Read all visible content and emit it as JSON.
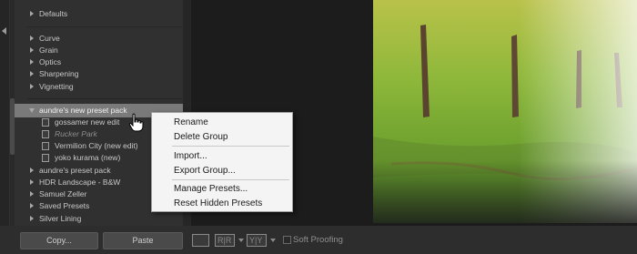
{
  "preset_tree": {
    "rows": [
      {
        "label": "Defaults",
        "kind": "folder"
      },
      {
        "label": "Curve",
        "kind": "folder"
      },
      {
        "label": "Grain",
        "kind": "folder"
      },
      {
        "label": "Optics",
        "kind": "folder"
      },
      {
        "label": "Sharpening",
        "kind": "folder"
      },
      {
        "label": "Vignetting",
        "kind": "folder"
      },
      {
        "label": "aundre's new preset pack",
        "kind": "folder-open",
        "selected": true
      },
      {
        "label": "gossamer new edit",
        "kind": "preset"
      },
      {
        "label": "Rucker Park",
        "kind": "preset",
        "dim": true
      },
      {
        "label": "Vermilion City (new edit)",
        "kind": "preset"
      },
      {
        "label": "yoko kurama (new)",
        "kind": "preset"
      },
      {
        "label": "aundre's preset pack",
        "kind": "folder"
      },
      {
        "label": "HDR Landscape - B&W",
        "kind": "folder"
      },
      {
        "label": "Samuel Zeller",
        "kind": "folder"
      },
      {
        "label": "Saved Presets",
        "kind": "folder"
      },
      {
        "label": "Silver Lining",
        "kind": "folder"
      }
    ]
  },
  "context_menu": {
    "items": [
      "Rename",
      "Delete Group",
      "Import...",
      "Export Group...",
      "Manage Presets...",
      "Reset Hidden Presets"
    ]
  },
  "bottom_bar": {
    "copy_label": "Copy...",
    "paste_label": "Paste",
    "ref_view_label": "R|R",
    "compare_label": "Y|Y",
    "soft_proofing_label": "Soft Proofing"
  },
  "icons": {
    "cursor": "hand-pointer-icon",
    "panel_collapse": "triangle-left-icon",
    "loupe_view": "loupe-view-icon",
    "reference_view": "reference-view-icon",
    "before_after": "before-after-icon"
  },
  "colors": {
    "panel_bg": "#303030",
    "selected_row": "#7a7a7a",
    "menu_bg": "#f4f4f4",
    "filmstrip_bar": "#2d2d2d"
  }
}
